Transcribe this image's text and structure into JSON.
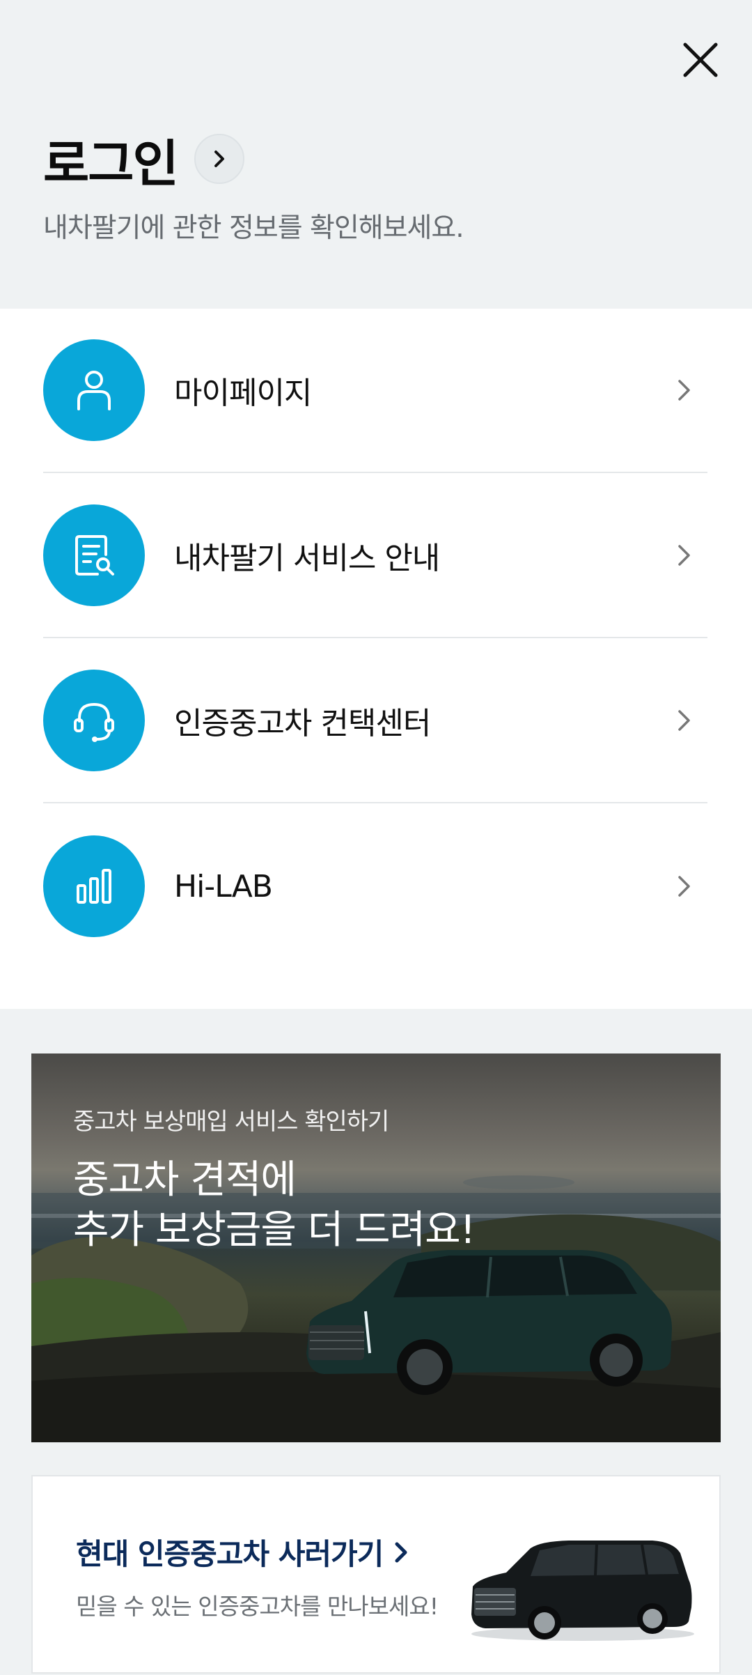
{
  "header": {
    "login_title": "로그인",
    "login_subtitle": "내차팔기에 관한 정보를 확인해보세요."
  },
  "menu": {
    "items": [
      {
        "label": "마이페이지",
        "icon": "person-icon"
      },
      {
        "label": "내차팔기 서비스 안내",
        "icon": "document-search-icon"
      },
      {
        "label": "인증중고차 컨택센터",
        "icon": "headset-icon"
      },
      {
        "label": "Hi-LAB",
        "icon": "bar-chart-icon"
      }
    ]
  },
  "banner": {
    "subtitle": "중고차 보상매입 서비스 확인하기",
    "title": "중고차 견적에\n추가 보상금을 더 드려요!"
  },
  "card": {
    "title": "현대 인증중고차 사러가기",
    "subtitle": "믿을 수 있는 인증중고차를 만나보세요!"
  },
  "colors": {
    "accent": "#09a7d9",
    "header_bg": "#eff2f3",
    "card_title": "#0b2a5a"
  }
}
